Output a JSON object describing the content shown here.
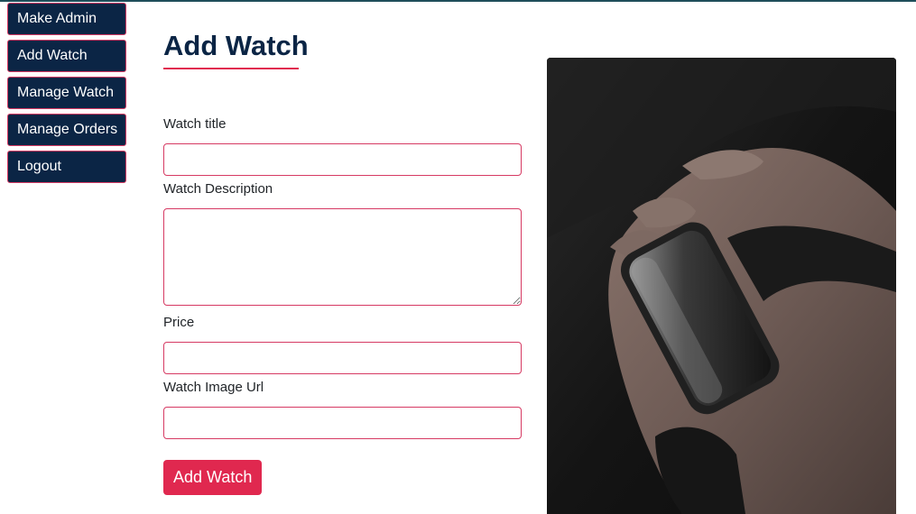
{
  "sidebar": {
    "items": [
      {
        "label": "Make Admin"
      },
      {
        "label": "Add Watch"
      },
      {
        "label": "Manage Watch"
      },
      {
        "label": "Manage Orders"
      },
      {
        "label": "Logout"
      }
    ]
  },
  "main": {
    "title": "Add Watch",
    "form": {
      "title_label": "Watch title",
      "title_value": "",
      "description_label": "Watch Description",
      "description_value": "",
      "price_label": "Price",
      "price_value": "",
      "image_url_label": "Watch Image Url",
      "image_url_value": "",
      "submit_label": "Add Watch"
    }
  },
  "colors": {
    "navy": "#0b2545",
    "accent": "#e0284f",
    "border_accent": "#d63a63"
  },
  "image": {
    "subject": "smartwatch on wrist photo"
  }
}
